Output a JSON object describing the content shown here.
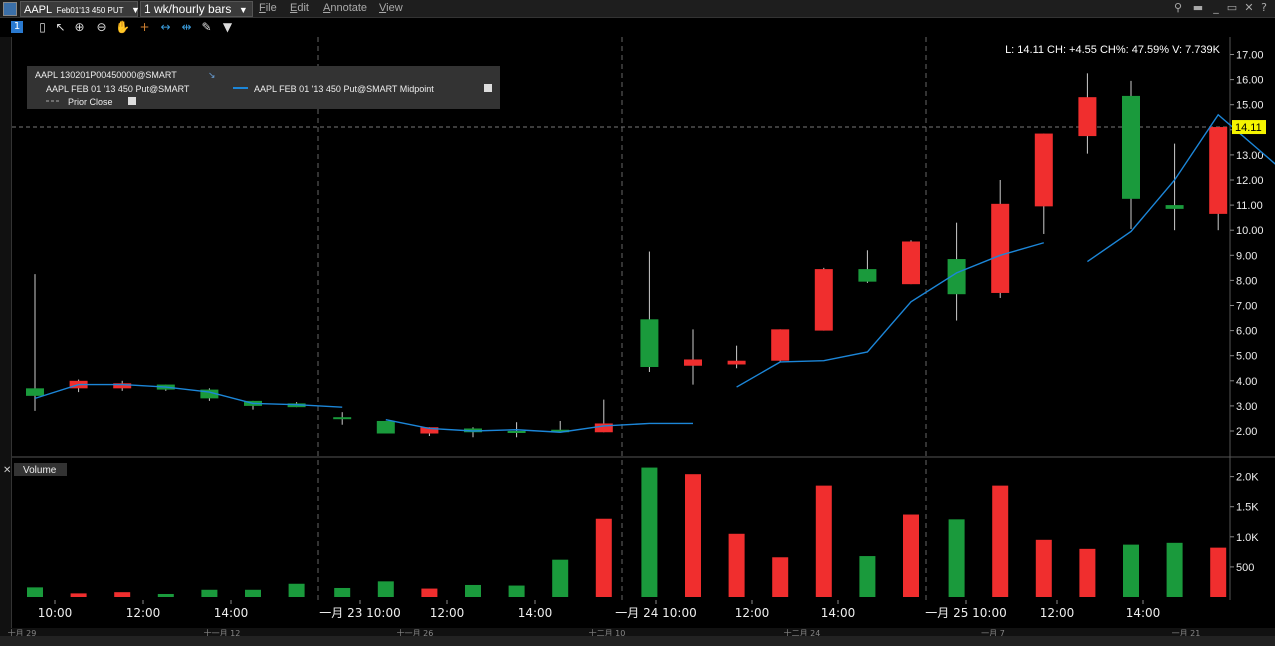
{
  "window": {
    "symbol_combo": "AAPL",
    "symbol_detail": "Feb01'13 450 PUT",
    "timeframe_combo": "1 wk/hourly bars",
    "menu": [
      "File",
      "Edit",
      "Annotate",
      "View"
    ]
  },
  "toolbar": {
    "badge": "1",
    "icons": [
      "bar-style-icon",
      "crosshair-cursor-icon",
      "zoom-in-icon",
      "zoom-out-icon",
      "pan-hand-icon",
      "crosshair-icon",
      "expand-horizontal-icon",
      "compress-horizontal-icon",
      "wrench-icon",
      "dropdown-triangle-icon"
    ]
  },
  "status": "L: 14.11 CH: +4.55 CH%: 47.59% V: 7.739K",
  "last_price": "14.11",
  "legend": {
    "contract": "AAPL 130201P00450000@SMART",
    "series1": "AAPL FEB 01 '13 450  Put@SMART",
    "series2": "AAPL FEB 01 '13 450  Put@SMART Midpoint",
    "prior_close": "Prior Close"
  },
  "volume_label": "Volume",
  "colors": {
    "up": "#1a9a3c",
    "down": "#f02e2e",
    "midpoint": "#1c86d8",
    "highlight": "#f4f400"
  },
  "chart_data": [
    {
      "type": "candlestick",
      "title": "AAPL Feb01'13 450 PUT",
      "ylim": [
        1.5,
        17.5
      ],
      "yticks": [
        "2.00",
        "3.00",
        "4.00",
        "5.00",
        "6.00",
        "7.00",
        "8.00",
        "9.00",
        "10.00",
        "11.00",
        "12.00",
        "13.00",
        "14.00",
        "15.00",
        "16.00",
        "17.00"
      ],
      "xlabels": [
        "10:00",
        "12:00",
        "14:00",
        "一月 23  10:00",
        "12:00",
        "14:00",
        "一月 24  10:00",
        "12:00",
        "14:00",
        "一月 25  10:00",
        "12:00",
        "14:00"
      ],
      "candles": [
        {
          "o": 3.4,
          "h": 8.25,
          "l": 2.8,
          "c": 3.7
        },
        {
          "o": 4.0,
          "h": 4.05,
          "l": 3.55,
          "c": 3.7
        },
        {
          "o": 3.9,
          "h": 4.0,
          "l": 3.6,
          "c": 3.7
        },
        {
          "o": 3.65,
          "h": 3.85,
          "l": 3.6,
          "c": 3.85
        },
        {
          "o": 3.3,
          "h": 3.7,
          "l": 3.2,
          "c": 3.65
        },
        {
          "o": 3.0,
          "h": 3.2,
          "l": 2.85,
          "c": 3.2
        },
        {
          "o": 2.95,
          "h": 3.15,
          "l": 2.95,
          "c": 3.1
        },
        {
          "o": 2.5,
          "h": 2.75,
          "l": 2.25,
          "c": 2.55
        },
        {
          "o": 1.9,
          "h": 2.4,
          "l": 1.9,
          "c": 2.4
        },
        {
          "o": 2.15,
          "h": 2.15,
          "l": 1.8,
          "c": 1.9
        },
        {
          "o": 1.95,
          "h": 2.15,
          "l": 1.75,
          "c": 2.1
        },
        {
          "o": 2.0,
          "h": 2.35,
          "l": 1.75,
          "c": 2.0
        },
        {
          "o": 1.95,
          "h": 2.4,
          "l": 1.95,
          "c": 2.05
        },
        {
          "o": 2.3,
          "h": 3.25,
          "l": 1.95,
          "c": 1.95
        },
        {
          "o": 4.55,
          "h": 9.15,
          "l": 4.35,
          "c": 6.45
        },
        {
          "o": 4.85,
          "h": 6.05,
          "l": 3.85,
          "c": 4.6
        },
        {
          "o": 4.8,
          "h": 5.4,
          "l": 4.5,
          "c": 4.65
        },
        {
          "o": 6.05,
          "h": 6.05,
          "l": 4.75,
          "c": 4.8
        },
        {
          "o": 8.45,
          "h": 8.5,
          "l": 6.0,
          "c": 6.0
        },
        {
          "o": 7.95,
          "h": 9.2,
          "l": 7.9,
          "c": 8.45
        },
        {
          "o": 9.55,
          "h": 9.6,
          "l": 7.85,
          "c": 7.85
        },
        {
          "o": 7.45,
          "h": 10.3,
          "l": 6.4,
          "c": 8.85
        },
        {
          "o": 11.05,
          "h": 12.0,
          "l": 7.3,
          "c": 7.5
        },
        {
          "o": 13.85,
          "h": 13.85,
          "l": 9.85,
          "c": 10.95
        },
        {
          "o": 15.3,
          "h": 16.25,
          "l": 13.05,
          "c": 13.75
        },
        {
          "o": 11.25,
          "h": 15.95,
          "l": 10.05,
          "c": 15.35
        },
        {
          "o": 10.85,
          "h": 13.45,
          "l": 10.0,
          "c": 11.0
        },
        {
          "o": 14.11,
          "h": 14.11,
          "l": 10.0,
          "c": 10.65
        }
      ],
      "midpoint_segments": [
        [
          3.3,
          3.85,
          3.85,
          3.75,
          3.55,
          3.1,
          3.05,
          2.95
        ],
        [
          2.45,
          2.1,
          2.0,
          2.05,
          1.95,
          2.2,
          2.3,
          2.3
        ],
        [
          3.75,
          4.75,
          4.8,
          5.15,
          7.15,
          8.3,
          9.0,
          9.5
        ],
        [
          8.75,
          9.95,
          12.0,
          14.6,
          13.1,
          11.6,
          14.5
        ]
      ],
      "prior_close": 14.11
    },
    {
      "type": "bar",
      "title": "Volume",
      "ylim": [
        0,
        2250
      ],
      "yticks": [
        "500",
        "1.0K",
        "1.5K",
        "2.0K"
      ],
      "values": [
        160,
        60,
        80,
        50,
        120,
        120,
        220,
        150,
        260,
        140,
        200,
        190,
        620,
        1300,
        2150,
        2040,
        1050,
        660,
        1850,
        680,
        1370,
        1290,
        1850,
        950,
        800,
        870,
        900,
        820
      ],
      "up": [
        true,
        false,
        false,
        true,
        true,
        true,
        true,
        true,
        true,
        false,
        true,
        true,
        true,
        false,
        true,
        false,
        false,
        false,
        false,
        true,
        false,
        true,
        false,
        false,
        false,
        true,
        true,
        false
      ]
    }
  ],
  "timeline": [
    "十月 29",
    "十一月 12",
    "十一月 26",
    "十二月 10",
    "十二月 24",
    "一月 7",
    "一月 21"
  ]
}
